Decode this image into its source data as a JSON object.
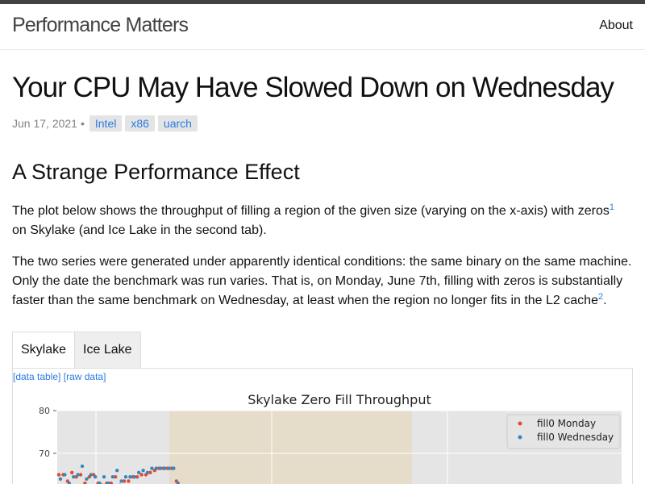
{
  "header": {
    "site_title": "Performance Matters",
    "nav_about": "About"
  },
  "post": {
    "title": "Your CPU May Have Slowed Down on Wednesday",
    "date": "Jun 17, 2021",
    "separator": "•",
    "tags": [
      "Intel",
      "x86",
      "uarch"
    ]
  },
  "section": {
    "heading": "A Strange Performance Effect",
    "para1_text": "The plot below shows the throughput of filling a region of the given size (varying on the x-axis) with zeros",
    "para1_footnote": "1",
    "para1_text2": "on Skylake (and Ice Lake in the second tab).",
    "para2_text": "The two series were generated under apparently identical conditions: the same binary on the same machine. Only the date the benchmark was run varies. That is, on Monday, June 7th, filling with zeros is substantially faster than the same benchmark on Wednesday, at least when the region no longer fits in the L2 cache",
    "para2_footnote": "2",
    "para2_end": "."
  },
  "tabs": [
    {
      "label": "Skylake",
      "active": true
    },
    {
      "label": "Ice Lake",
      "active": false
    }
  ],
  "data_links": {
    "data_table": "[data table]",
    "raw_data": "[raw data]"
  },
  "colors": {
    "link": "#2a7ae2",
    "monday": "#e24a33",
    "wednesday": "#348abd",
    "plot_bg": "#e5e5e5",
    "l2_band": "#e5ddca"
  },
  "chart_data": {
    "type": "scatter",
    "title": "Skylake Zero Fill Throughput",
    "y_ticks": [
      70,
      80
    ],
    "legend": "top-right",
    "grid": true,
    "series": [
      {
        "name": "fill0 Monday",
        "color": "#e24a33",
        "y": [
          65,
          65,
          63.5,
          65.5,
          64.5,
          65,
          63,
          64.5,
          65,
          63,
          62.5,
          63,
          63,
          64.5,
          62.5,
          63.5,
          63.5,
          64.5,
          64.5,
          65,
          65,
          65.5,
          66,
          66.5,
          66.5,
          66.5,
          66.5,
          63.5
        ]
      },
      {
        "name": "fill0 Wednesday",
        "color": "#348abd",
        "y": [
          64,
          65,
          63,
          64.5,
          65,
          67,
          64,
          65,
          64.5,
          63,
          64.5,
          63,
          64.5,
          66,
          63.5,
          64.5,
          64.5,
          64.5,
          65.5,
          66,
          65.5,
          66.5,
          66.5,
          66.5,
          66.5,
          66.5,
          66.5,
          63
        ]
      }
    ]
  }
}
